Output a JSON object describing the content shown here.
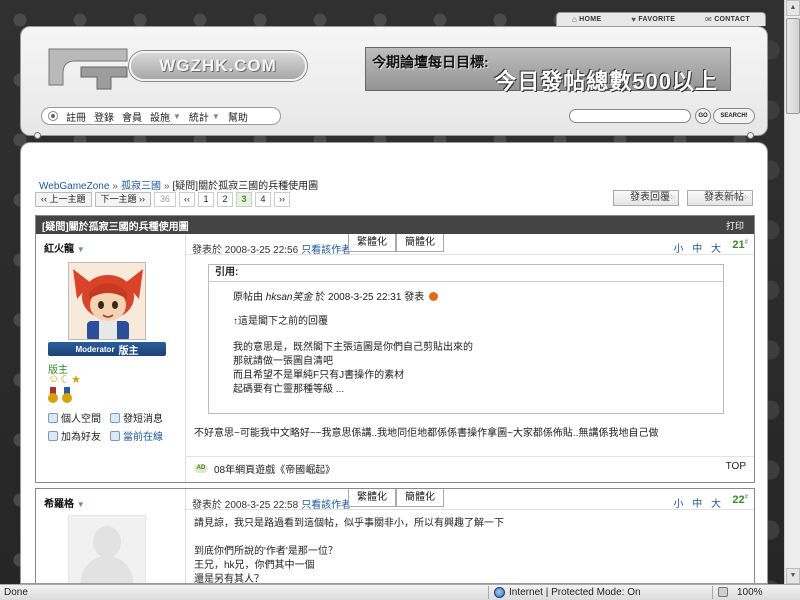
{
  "top_links": {
    "home": "HOME",
    "favorite": "FAVORITE",
    "contact": "CONTACT"
  },
  "header": {
    "logo_text": "WGZHK.COM",
    "banner_line1": "今期論壇每日目標:",
    "banner_line2": "今日發帖總數500以上",
    "menu": [
      "註冊",
      "登錄",
      "會員",
      "設施",
      "統計",
      "幫助"
    ],
    "search_placeholder": "",
    "go_label": "GO",
    "search_label": "SEARCH!"
  },
  "breadcrumb": {
    "home": "WebGameZone",
    "forum": "孤寂三國",
    "thread": "[疑問]關於孤寂三國的兵種使用圖",
    "sep": "»"
  },
  "pager": {
    "prev_label": "‹‹ 上一主題",
    "next_label": "下一主題 ››",
    "pages": [
      {
        "label": "36",
        "state": "muted"
      },
      {
        "label": "‹‹",
        "state": "normal"
      },
      {
        "label": "1",
        "state": "normal"
      },
      {
        "label": "2",
        "state": "normal"
      },
      {
        "label": "3",
        "state": "current"
      },
      {
        "label": "4",
        "state": "normal"
      },
      {
        "label": "››",
        "state": "normal"
      }
    ]
  },
  "actions": {
    "reply_label": "發表回覆",
    "new_label": "發表新帖"
  },
  "thread": {
    "title": "[疑問]關於孤寂三國的兵種使用圖",
    "print_label": "打印"
  },
  "post1": {
    "author": "紅火龍",
    "role_badge": "Moderator",
    "role_title": "版主",
    "rank": "版主",
    "links": [
      "個人空間",
      "發短消息",
      "加為好友",
      "當前在線"
    ],
    "meta_prefix": "發表於",
    "datetime": "2008-3-25 22:56",
    "only_author": "只看該作者",
    "tab_traditional": "繁體化",
    "tab_simplified": "簡體化",
    "font_sizes": "小 中 大",
    "floor": "21",
    "quote_title": "引用:",
    "quote_orig_prefix": "原帖由",
    "quote_orig_user": "hksan笑金",
    "quote_orig_middle": "於 2008-3-25 22:31 發表",
    "quote_lines": [
      "↑這是閣下之前的回覆",
      "我的意思是，既然閣下主張這圖是你們自己剪貼出來的",
      "那就請做一張圖自清吧",
      "而且希望不是單純F只有J書操作的素材",
      "起碼要有亡靈那種等級 ..."
    ],
    "reply": "不好意思~可能我中文略好~~我意思係講..我地同佢地都係係書操作拿圖~大家都係佈貼..無講係我地自己做",
    "ad_badge": "AD",
    "ad_text": "08年網頁遊戲《帝國崛起》",
    "top_label": "TOP"
  },
  "post2": {
    "author": "希羅格",
    "meta_prefix": "發表於",
    "datetime": "2008-3-25 22:58",
    "only_author": "只看該作者",
    "tab_traditional": "繁體化",
    "tab_simplified": "簡體化",
    "font_sizes": "小 中 大",
    "floor": "22",
    "lines": [
      "請見諒，我只是路過看到這個帖，似乎事關非小，所以有興趣了解一下",
      "",
      "到底你們所說的'作者'是那一位？",
      "王兄，hk兄，你們其中一個",
      "還是另有其人？"
    ]
  },
  "statusbar": {
    "done": "Done",
    "zone": "Internet | Protected Mode: On",
    "zoom": "100%"
  }
}
